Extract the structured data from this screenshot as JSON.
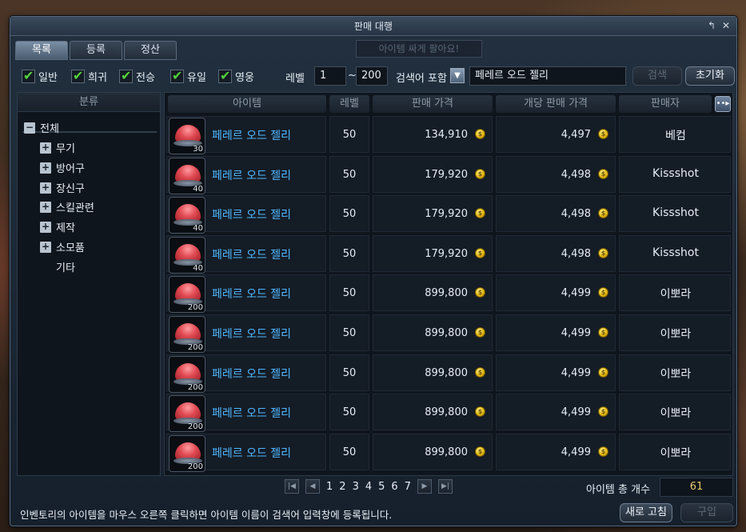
{
  "window": {
    "title": "판매 대행",
    "notice_placeholder": "아이템 싸게 팔아요!"
  },
  "tabs": [
    {
      "label": "목록",
      "active": true
    },
    {
      "label": "등록",
      "active": false
    },
    {
      "label": "정산",
      "active": false
    }
  ],
  "filters": {
    "grades": [
      {
        "label": "일반",
        "checked": true
      },
      {
        "label": "희귀",
        "checked": true
      },
      {
        "label": "전승",
        "checked": true
      },
      {
        "label": "유일",
        "checked": true
      },
      {
        "label": "영웅",
        "checked": true
      }
    ],
    "level_label": "레벨",
    "level_min": "1",
    "level_sep": "~",
    "level_max": "200",
    "search_mode": "검색어 포함",
    "search_query": "페레르 오드 젤리",
    "search_button": "검색",
    "reset_button": "초기화"
  },
  "categories": {
    "header": "분류",
    "items": [
      {
        "label": "전체",
        "expander": "−"
      },
      {
        "label": "무기",
        "expander": "+"
      },
      {
        "label": "방어구",
        "expander": "+"
      },
      {
        "label": "장신구",
        "expander": "+"
      },
      {
        "label": "스킬관련",
        "expander": "+"
      },
      {
        "label": "제작",
        "expander": "+"
      },
      {
        "label": "소모품",
        "expander": "+"
      },
      {
        "label": "기타",
        "expander": ""
      }
    ]
  },
  "table": {
    "columns": [
      "아이템",
      "레벨",
      "판매 가격",
      "개당 판매 가격",
      "판매자"
    ],
    "rows": [
      {
        "name": "페레르 오드 젤리",
        "qty": "30",
        "level": "50",
        "price": "134,910",
        "unit_price": "4,497",
        "seller": "베컴"
      },
      {
        "name": "페레르 오드 젤리",
        "qty": "40",
        "level": "50",
        "price": "179,920",
        "unit_price": "4,498",
        "seller": "Kissshot"
      },
      {
        "name": "페레르 오드 젤리",
        "qty": "40",
        "level": "50",
        "price": "179,920",
        "unit_price": "4,498",
        "seller": "Kissshot"
      },
      {
        "name": "페레르 오드 젤리",
        "qty": "40",
        "level": "50",
        "price": "179,920",
        "unit_price": "4,498",
        "seller": "Kissshot"
      },
      {
        "name": "페레르 오드 젤리",
        "qty": "200",
        "level": "50",
        "price": "899,800",
        "unit_price": "4,499",
        "seller": "이뽀라"
      },
      {
        "name": "페레르 오드 젤리",
        "qty": "200",
        "level": "50",
        "price": "899,800",
        "unit_price": "4,499",
        "seller": "이뽀라"
      },
      {
        "name": "페레르 오드 젤리",
        "qty": "200",
        "level": "50",
        "price": "899,800",
        "unit_price": "4,499",
        "seller": "이뽀라"
      },
      {
        "name": "페레르 오드 젤리",
        "qty": "200",
        "level": "50",
        "price": "899,800",
        "unit_price": "4,499",
        "seller": "이뽀라"
      },
      {
        "name": "페레르 오드 젤리",
        "qty": "200",
        "level": "50",
        "price": "899,800",
        "unit_price": "4,499",
        "seller": "이뽀라"
      }
    ]
  },
  "pagination": {
    "pages": [
      "1",
      "2",
      "3",
      "4",
      "5",
      "6",
      "7"
    ],
    "total_label": "아이템 총 개수",
    "total_count": "61"
  },
  "footer": {
    "hint": "인벤토리의 아이템을 마우스 오른쪽 클릭하면 아이템 이름이 검색어 입력창에 등록됩니다.",
    "refresh_button": "새로 고침",
    "buy_button": "구입"
  },
  "colors": {
    "item_name": "#4fb8ff",
    "check": "#55d23a",
    "total_count": "#e8c86a"
  }
}
